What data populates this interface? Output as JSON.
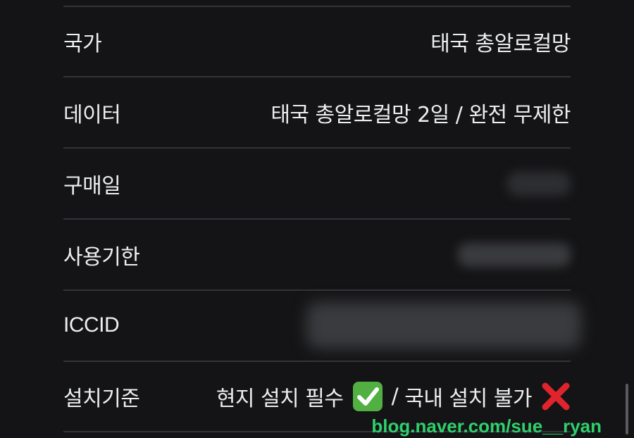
{
  "rows": [
    {
      "label": "국가",
      "value": "태국 총알로컬망"
    },
    {
      "label": "데이터",
      "value": "태국 총알로컬망 2일 / 완전 무제한"
    },
    {
      "label": "구매일",
      "value": ""
    },
    {
      "label": "사용기한",
      "value": ""
    },
    {
      "label": "ICCID",
      "value": ""
    },
    {
      "label": "설치기준",
      "value_part1": "현지 설치 필수",
      "value_sep": "/",
      "value_part2": "국내 설치 불가",
      "icon_check": "check-mark-button-icon",
      "icon_cross": "cross-mark-icon"
    }
  ],
  "watermark": "blog.naver.com/sue__ryan",
  "colors": {
    "background": "#141416",
    "text": "#eceef0",
    "divider": "#333437",
    "watermark": "#2fd06c",
    "check_bg": "#52b043",
    "cross": "#e0242e"
  }
}
